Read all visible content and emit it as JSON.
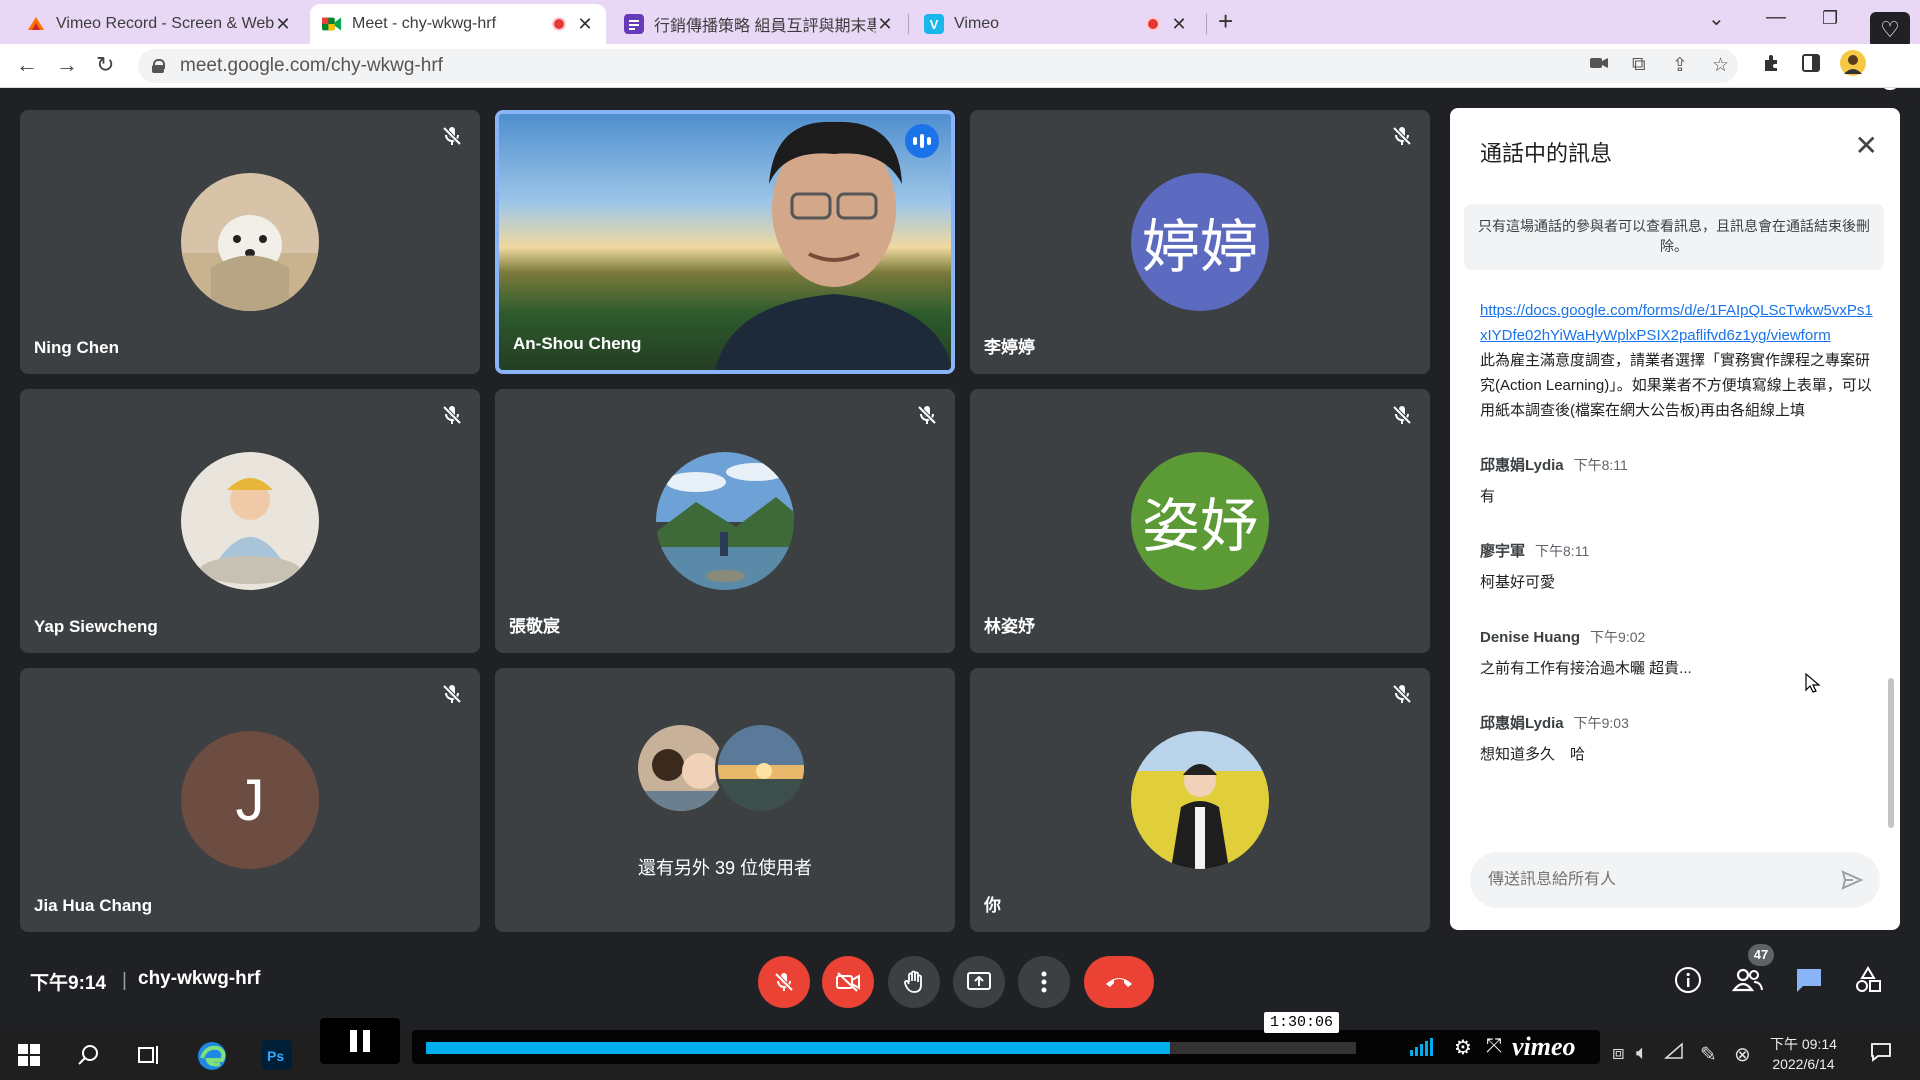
{
  "browser": {
    "tabs": [
      {
        "title": "Vimeo Record - Screen & Web",
        "favicon_color": "#ff6f00"
      },
      {
        "title": "Meet - chy-wkwg-hrf",
        "favicon_color": "#00832d"
      },
      {
        "title": "行銷傳播策略 組員互評與期末專",
        "favicon_color": "#673ab7"
      },
      {
        "title": "Vimeo",
        "favicon_color": "#1ab7ea"
      }
    ],
    "url": "meet.google.com/chy-wkwg-hrf"
  },
  "meeting": {
    "participants": [
      {
        "name": "Ning Chen",
        "avatar_type": "photo"
      },
      {
        "name": "An-Shou Cheng",
        "avatar_type": "video"
      },
      {
        "name": "李婷婷",
        "avatar_type": "text",
        "initials": "婷婷",
        "color": "#5c6bc0"
      },
      {
        "name": "Yap Siewcheng",
        "avatar_type": "photo"
      },
      {
        "name": "張敬宸",
        "avatar_type": "photo"
      },
      {
        "name": "林姿妤",
        "avatar_type": "text",
        "initials": "姿妤",
        "color": "#5b9a35"
      },
      {
        "name": "Jia Hua Chang",
        "avatar_type": "text",
        "initials": "J",
        "color": "#6d4c41"
      },
      {
        "name": "",
        "avatar_type": "group",
        "label": "還有另外 39 位使用者"
      },
      {
        "name": "你",
        "avatar_type": "photo"
      }
    ],
    "time": "下午9:14",
    "code": "chy-wkwg-hrf",
    "participant_count": "47"
  },
  "chat": {
    "title": "通話中的訊息",
    "notice": "只有這場通話的參與者可以查看訊息，且訊息會在通話結束後刪除。",
    "link": "https://docs.google.com/forms/d/e/1FAIpQLScTwkw5vxPs1xIYDfe02hYiWaHyWplxPSIX2paflifvd6z1yg/viewform",
    "link_description": "此為雇主滿意度調查，請業者選擇「實務實作課程之專案研究(Action Learning)」。如果業者不方便填寫線上表單，可以用紙本調查後(檔案在網大公告板)再由各組線上填",
    "messages": [
      {
        "sender": "邱惠娟Lydia",
        "time": "下午8:11",
        "text": "有"
      },
      {
        "sender": "廖宇軍",
        "time": "下午8:11",
        "text": "柯基好可愛"
      },
      {
        "sender": "Denise Huang",
        "time": "下午9:02",
        "text": "之前有工作有接洽過木曬 超貴..."
      },
      {
        "sender": "邱惠娟Lydia",
        "time": "下午9:03",
        "text": "想知道多久　哈"
      }
    ],
    "input_placeholder": "傳送訊息給所有人"
  },
  "player": {
    "timestamp": "1:30:06",
    "progress": 0.8,
    "brand": "vimeo"
  },
  "taskbar": {
    "time": "下午 09:14",
    "date": "2022/6/14"
  }
}
